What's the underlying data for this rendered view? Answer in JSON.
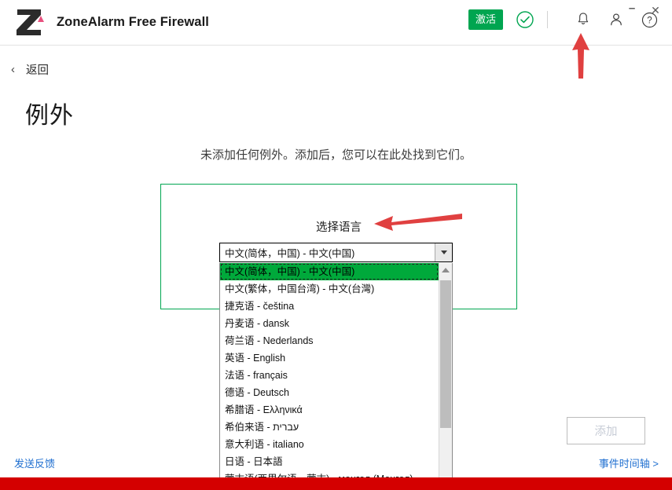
{
  "window": {
    "app_title": "ZoneAlarm Free Firewall",
    "minimize_label": "–",
    "close_label": "✕"
  },
  "header": {
    "activate_label": "激活",
    "status_icon": "check-circle-icon",
    "notifications_icon": "bell-icon",
    "account_icon": "person-icon",
    "help_icon": "help-icon",
    "accent_green": "#00a550"
  },
  "nav": {
    "back_label": "返回",
    "back_icon": "chevron-left-icon"
  },
  "page": {
    "title": "例外",
    "empty_message": "未添加任何例外。添加后，您可以在此处找到它们。",
    "panel_border_color": "#00a651"
  },
  "language_dialog": {
    "title": "选择语言",
    "selected_value": "中文(简体，中国) - 中文(中国)",
    "dropdown_arrow_icon": "chevron-down-icon",
    "scroll_up_icon": "scroll-up-arrow-icon",
    "selected_index": 0,
    "options": [
      "中文(简体，中国) - 中文(中国)",
      "中文(繁体，中国台湾) - 中文(台灣)",
      "捷克语 - čeština",
      "丹麦语 - dansk",
      "荷兰语 - Nederlands",
      "英语 - English",
      "法语 - français",
      "德语 - Deutsch",
      "希腊语 - Ελληνικά",
      "希伯来语 - עברית",
      "意大利语 - italiano",
      "日语 - 日本語",
      "蒙古语(西里尔语、蒙古) - монгол (Монгол)"
    ]
  },
  "footer": {
    "add_label": "添加",
    "feedback_label": "发送反馈",
    "timeline_label": "事件时间轴 >",
    "link_color": "#1f6fd0",
    "bar_color": "#d40000"
  },
  "annotations": {
    "arrow_color": "#e04040",
    "arrow_to_language": "left-pointing-arrow",
    "arrow_to_account": "up-pointing-arrow"
  }
}
